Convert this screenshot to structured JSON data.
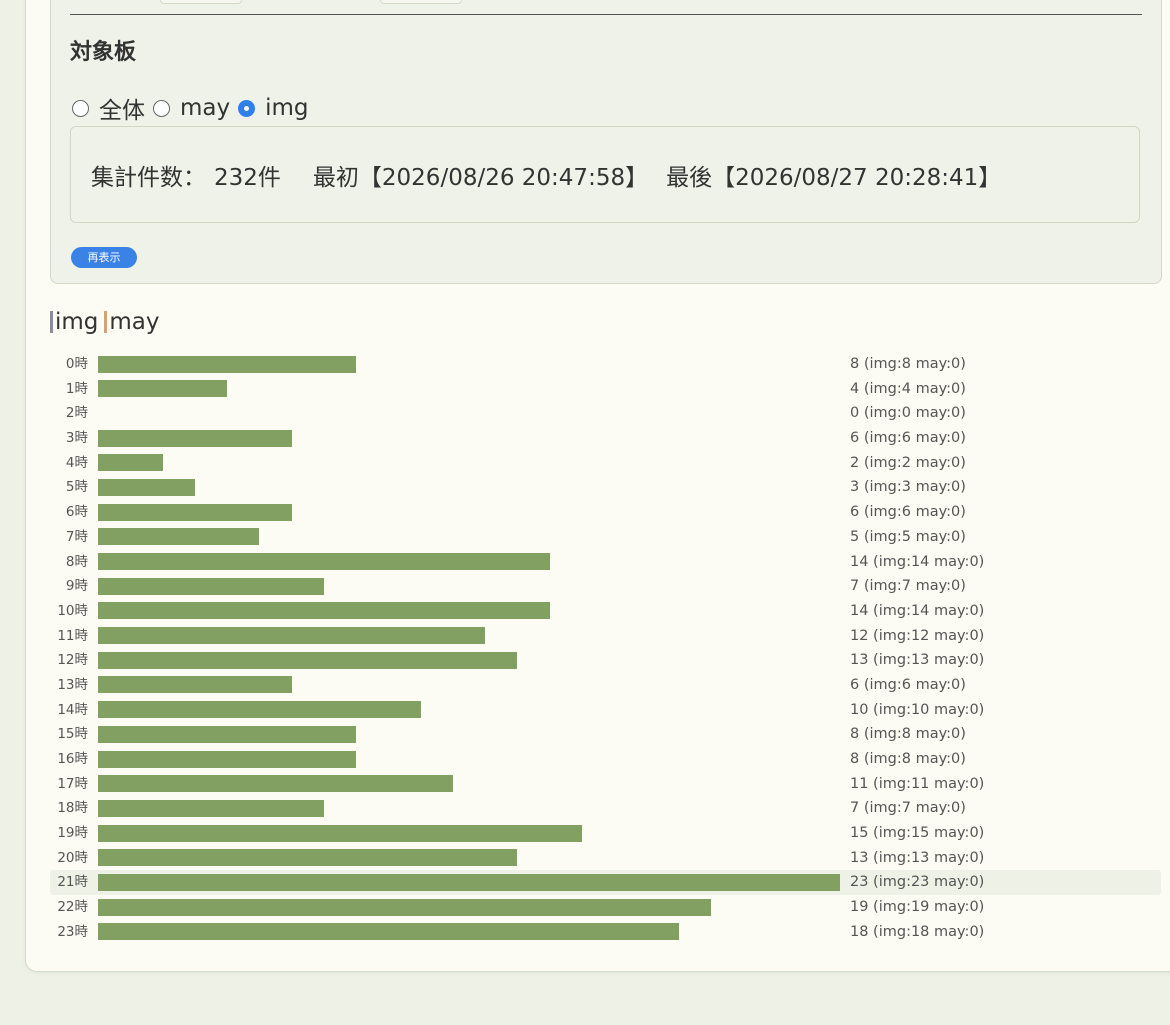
{
  "filter": {
    "section_title": "対象板",
    "options": [
      {
        "label": "全体",
        "checked": false
      },
      {
        "label": "may",
        "checked": false
      },
      {
        "label": "img",
        "checked": true
      }
    ],
    "summary": {
      "count_label": "集計件数：",
      "count_value": "232件",
      "first_label": "最初",
      "first_value": "【2026/08/26 20:47:58】",
      "last_label": "最後",
      "last_value": "【2026/08/27 20:28:41】"
    },
    "redisplay_label": "再表示"
  },
  "legend": [
    {
      "label": "img",
      "color": "#82a062"
    },
    {
      "label": "may",
      "color": "#d2a27a"
    }
  ],
  "colors": {
    "bar": "#82a062",
    "accent": "#3b82e6",
    "highlight_row": "#eef1e6"
  },
  "chart_data": {
    "type": "bar",
    "orientation": "horizontal",
    "categories": [
      "0時",
      "1時",
      "2時",
      "3時",
      "4時",
      "5時",
      "6時",
      "7時",
      "8時",
      "9時",
      "10時",
      "11時",
      "12時",
      "13時",
      "14時",
      "15時",
      "16時",
      "17時",
      "18時",
      "19時",
      "20時",
      "21時",
      "22時",
      "23時"
    ],
    "series": [
      {
        "name": "img",
        "values": [
          8,
          4,
          0,
          6,
          2,
          3,
          6,
          5,
          14,
          7,
          14,
          12,
          13,
          6,
          10,
          8,
          8,
          11,
          7,
          15,
          13,
          23,
          19,
          18
        ]
      },
      {
        "name": "may",
        "values": [
          0,
          0,
          0,
          0,
          0,
          0,
          0,
          0,
          0,
          0,
          0,
          0,
          0,
          0,
          0,
          0,
          0,
          0,
          0,
          0,
          0,
          0,
          0,
          0
        ]
      }
    ],
    "totals": [
      8,
      4,
      0,
      6,
      2,
      3,
      6,
      5,
      14,
      7,
      14,
      12,
      13,
      6,
      10,
      8,
      8,
      11,
      7,
      15,
      13,
      23,
      19,
      18
    ],
    "value_labels": [
      "8 (img:8 may:0)",
      "4 (img:4 may:0)",
      "0 (img:0 may:0)",
      "6 (img:6 may:0)",
      "2 (img:2 may:0)",
      "3 (img:3 may:0)",
      "6 (img:6 may:0)",
      "5 (img:5 may:0)",
      "14 (img:14 may:0)",
      "7 (img:7 may:0)",
      "14 (img:14 may:0)",
      "12 (img:12 may:0)",
      "13 (img:13 may:0)",
      "6 (img:6 may:0)",
      "10 (img:10 may:0)",
      "8 (img:8 may:0)",
      "8 (img:8 may:0)",
      "11 (img:11 may:0)",
      "7 (img:7 may:0)",
      "15 (img:15 may:0)",
      "13 (img:13 may:0)",
      "23 (img:23 may:0)",
      "19 (img:19 may:0)",
      "18 (img:18 may:0)"
    ],
    "xlim": [
      0,
      23
    ],
    "highlight_index": 21,
    "grid": false
  }
}
